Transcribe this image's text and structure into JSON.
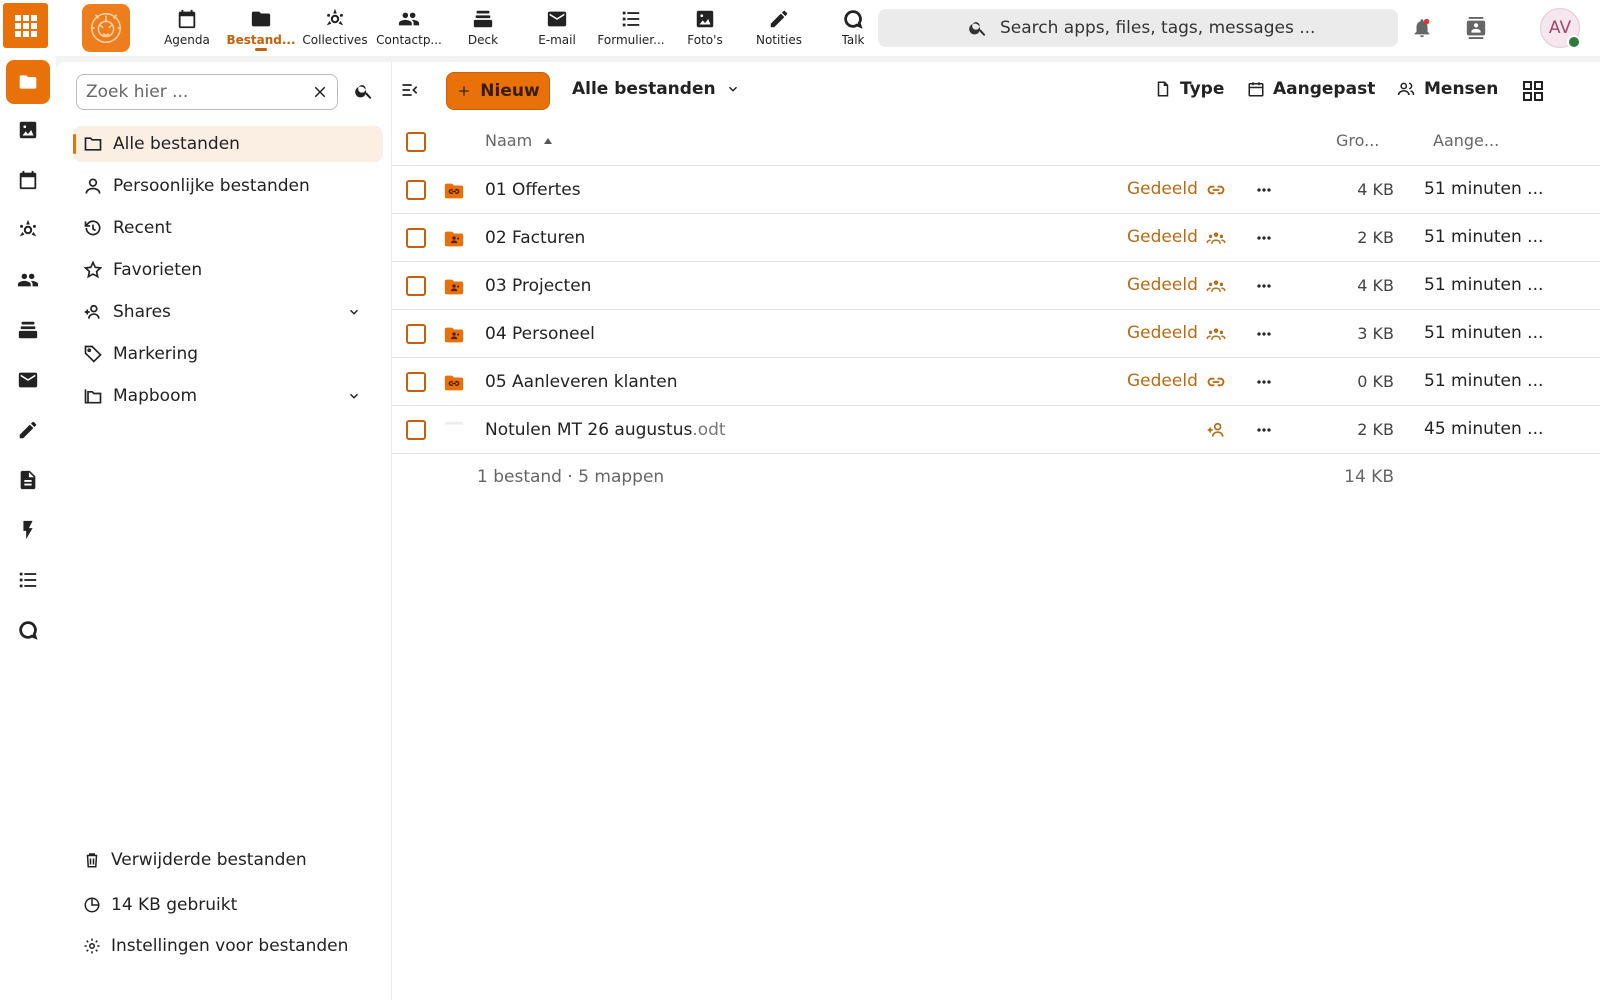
{
  "top_apps": [
    {
      "label": "Agenda",
      "icon": "calendar-icon"
    },
    {
      "label": "Bestand...",
      "icon": "folder-icon",
      "active": true
    },
    {
      "label": "Collectives",
      "icon": "collectives-icon"
    },
    {
      "label": "Contactp...",
      "icon": "contacts-icon"
    },
    {
      "label": "Deck",
      "icon": "deck-icon"
    },
    {
      "label": "E-mail",
      "icon": "mail-icon"
    },
    {
      "label": "Formulier...",
      "icon": "list-icon"
    },
    {
      "label": "Foto's",
      "icon": "image-icon"
    },
    {
      "label": "Notities",
      "icon": "pencil-icon"
    },
    {
      "label": "Talk",
      "icon": "talk-icon"
    }
  ],
  "search": {
    "placeholder": "Search apps, files, tags, messages ..."
  },
  "user": {
    "initials": "AV"
  },
  "nav": {
    "filter_placeholder": "Zoek hier ...",
    "items": [
      {
        "label": "Alle bestanden",
        "icon": "folder-icon",
        "active": true
      },
      {
        "label": "Persoonlijke bestanden",
        "icon": "user-icon"
      },
      {
        "label": "Recent",
        "icon": "history-icon"
      },
      {
        "label": "Favorieten",
        "icon": "star-icon"
      },
      {
        "label": "Shares",
        "icon": "share-icon",
        "expandable": true
      },
      {
        "label": "Markering",
        "icon": "tag-icon"
      },
      {
        "label": "Mapboom",
        "icon": "folder-tree-icon",
        "expandable": true
      }
    ],
    "footer": {
      "trash": "Verwijderde bestanden",
      "quota": "14 KB gebruikt",
      "settings": "Instellingen voor bestanden"
    }
  },
  "toolbar": {
    "new_label": "Nieuw",
    "breadcrumb": "Alle bestanden",
    "filter_type": "Type",
    "filter_modified": "Aangepast",
    "filter_people": "Mensen"
  },
  "table": {
    "headers": {
      "name": "Naam",
      "size": "Gro...",
      "modified": "Aange..."
    },
    "rows": [
      {
        "name": "01 Offertes",
        "ext": "",
        "kind": "folder-link",
        "shared": "Gedeeld",
        "share_icon": "link-icon",
        "size": "4 KB",
        "modified": "51 minuten ..."
      },
      {
        "name": "02 Facturen",
        "ext": "",
        "kind": "folder-group",
        "shared": "Gedeeld",
        "share_icon": "group-icon",
        "size": "2 KB",
        "modified": "51 minuten ..."
      },
      {
        "name": "03 Projecten",
        "ext": "",
        "kind": "folder-group",
        "shared": "Gedeeld",
        "share_icon": "group-icon",
        "size": "4 KB",
        "modified": "51 minuten ..."
      },
      {
        "name": "04 Personeel",
        "ext": "",
        "kind": "folder-group",
        "shared": "Gedeeld",
        "share_icon": "group-icon",
        "size": "3 KB",
        "modified": "51 minuten ..."
      },
      {
        "name": "05 Aanleveren klanten",
        "ext": "",
        "kind": "folder-link",
        "shared": "Gedeeld",
        "share_icon": "link-icon",
        "size": "0 KB",
        "modified": "51 minuten ..."
      },
      {
        "name": "Notulen MT 26 augustus",
        "ext": ".odt",
        "kind": "file",
        "shared": "",
        "share_icon": "add-user-icon",
        "size": "2 KB",
        "modified": "45 minuten ..."
      }
    ],
    "summary": "1 bestand · 5 mappen",
    "summary_size": "14 KB"
  },
  "colors": {
    "accent": "#e8710a",
    "accent_text": "#c2620a",
    "shared_text": "#b76b12"
  }
}
